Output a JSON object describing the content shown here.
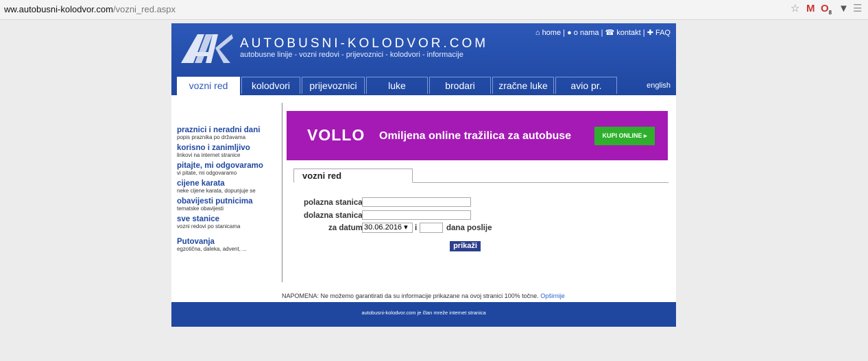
{
  "browser": {
    "url_domain": "ww.autobusni-kolodvor.com",
    "url_path": "/vozni_red.aspx",
    "badge_count": "8"
  },
  "header": {
    "brand": "AUTOBUSNI-KOLODVOR.COM",
    "tagline": "autobusne linije - vozni redovi - prijevoznici - kolodvori - informacije",
    "nav": {
      "home": "home",
      "sep1": "|",
      "onama": "o nama",
      "sep2": "|",
      "kontakt": "kontakt",
      "sep3": "|",
      "faq": "FAQ"
    },
    "lang": "english"
  },
  "tabs": [
    {
      "label": "vozni red"
    },
    {
      "label": "kolodvori"
    },
    {
      "label": "prijevoznici"
    },
    {
      "label": "luke"
    },
    {
      "label": "brodari"
    },
    {
      "label": "zračne luke"
    },
    {
      "label": "avio pr."
    }
  ],
  "sidebar": [
    {
      "title": "praznici i neradni dani",
      "desc": "popis praznika po državama"
    },
    {
      "title": "korisno i zanimljivo",
      "desc": "linkovi na internet stranice"
    },
    {
      "title": "pitajte, mi odgovaramo",
      "desc": "vi pitate, mi odgovaramo"
    },
    {
      "title": "cijene karata",
      "desc": "neke cijene karata, dopunjuje se"
    },
    {
      "title": "obavijesti putnicima",
      "desc": "tematske obavijesti"
    },
    {
      "title": "sve stanice",
      "desc": "vozni redovi po stanicama"
    },
    {
      "title": "Putovanja",
      "desc": "egzotična, daleka, advent, ..."
    }
  ],
  "banner": {
    "brand": "VOLLO",
    "slogan": "Omiljena online tražilica za autobuse",
    "cta": "KUPI ONLINE ▸"
  },
  "form": {
    "tab": "vozni red",
    "from_label": "polazna stanica",
    "from_value": "",
    "to_label": "dolazna stanica",
    "to_value": "",
    "date_label": "za datum",
    "date_value": "30.06.2016 ▾",
    "and": "i",
    "days_value": "",
    "days_label": "dana poslije",
    "submit": "prikaži"
  },
  "note": {
    "text": "NAPOMENA: Ne možemo garantirati da su informacije prikazane na ovoj stranici 100% točne.",
    "more": "Opširnije"
  },
  "footer": {
    "text": "autobusni-kolodvor.com je član mreže internet stranica"
  }
}
